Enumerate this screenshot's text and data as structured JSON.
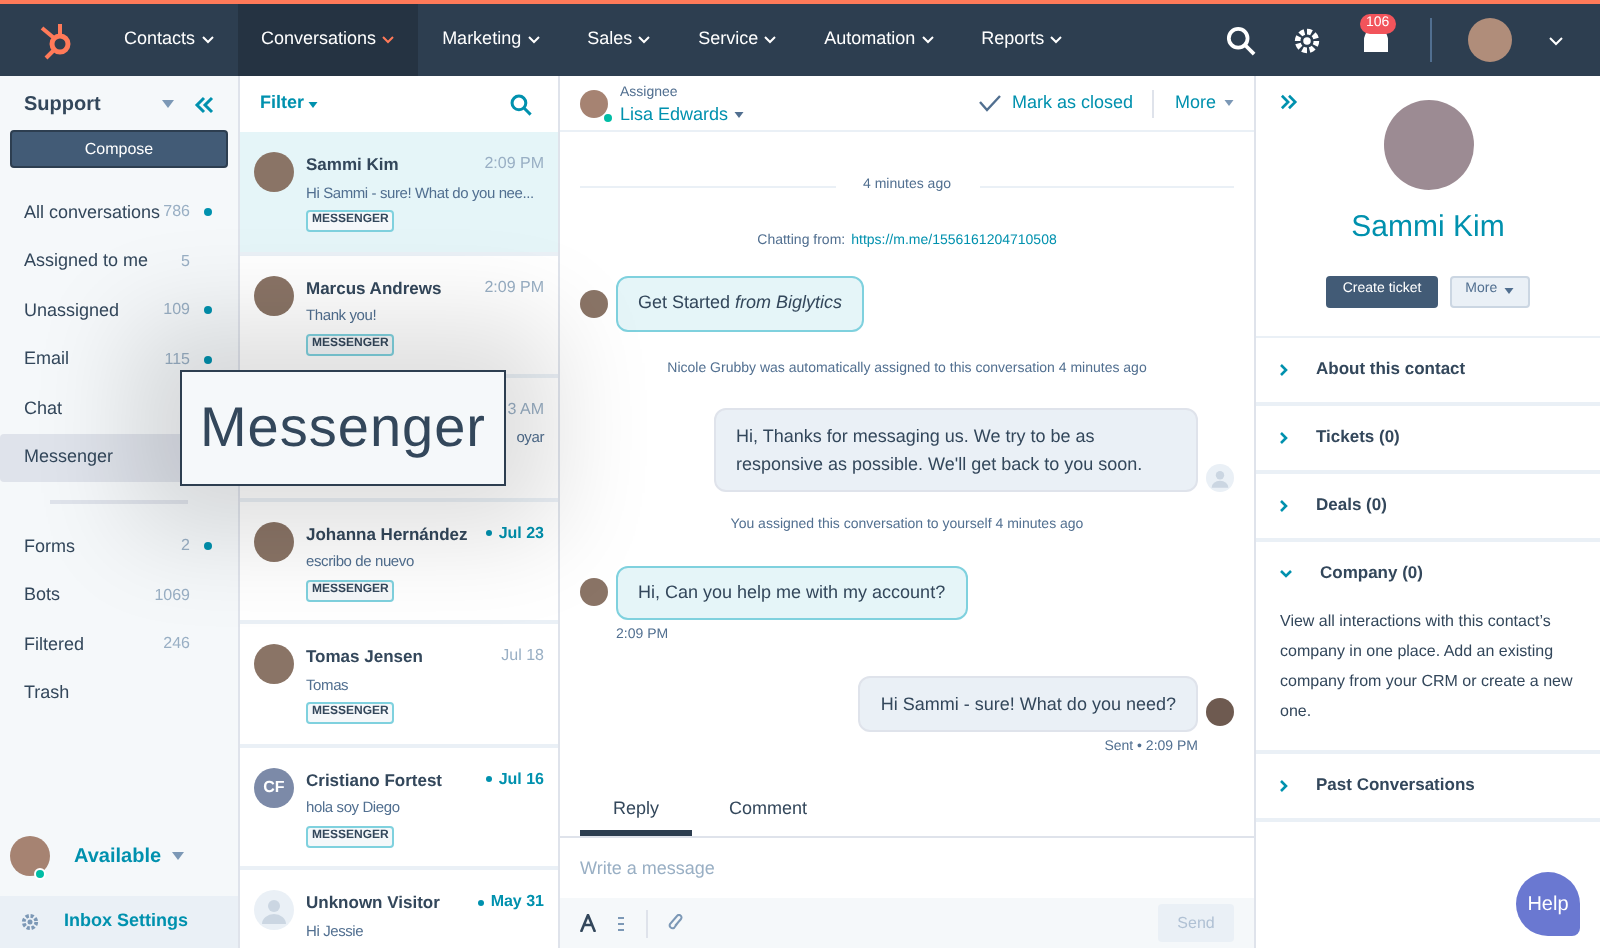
{
  "nav": {
    "items": [
      {
        "label": "Contacts",
        "selected": false
      },
      {
        "label": "Conversations",
        "selected": true
      },
      {
        "label": "Marketing",
        "selected": false
      },
      {
        "label": "Sales",
        "selected": false
      },
      {
        "label": "Service",
        "selected": false
      },
      {
        "label": "Automation",
        "selected": false
      },
      {
        "label": "Reports",
        "selected": false
      }
    ],
    "notifications": "106"
  },
  "sidebar": {
    "inbox": "Support",
    "compose": "Compose",
    "items": [
      {
        "label": "All conversations",
        "count": "786",
        "unread": true,
        "selected": false
      },
      {
        "label": "Assigned to me",
        "count": "5",
        "unread": false,
        "selected": false
      },
      {
        "label": "Unassigned",
        "count": "109",
        "unread": true,
        "selected": false
      },
      {
        "label": "Email",
        "count": "115",
        "unread": true,
        "selected": false
      },
      {
        "label": "Chat",
        "unread": false,
        "selected": false
      },
      {
        "label": "Messenger",
        "unread": false,
        "selected": true
      }
    ],
    "other_items": [
      {
        "label": "Forms",
        "count": "2",
        "unread": true,
        "selected": false
      },
      {
        "label": "Bots",
        "count": "1069",
        "unread": false,
        "selected": false
      },
      {
        "label": "Filtered",
        "count": "246",
        "unread": false,
        "selected": false
      },
      {
        "label": "Trash",
        "unread": false,
        "selected": false
      }
    ],
    "status": "Available",
    "settings": "Inbox Settings"
  },
  "conversations": {
    "filter": "Filter",
    "items": [
      {
        "photo": true,
        "name": "Sammi Kim",
        "time": "2:09 PM",
        "preview": "Hi Sammi - sure! What do you nee...",
        "tag": "MESSENGER",
        "unread": false,
        "selected": true
      },
      {
        "photo": true,
        "name": "Marcus Andrews",
        "time": "2:09 PM",
        "preview": "Thank you!",
        "tag": "MESSENGER",
        "unread": false,
        "selected": false
      },
      {
        "time": "3 AM",
        "preview": "oyar",
        "unread": false,
        "selected": false
      },
      {
        "photo": true,
        "name": "Johanna Hernández",
        "time": "Jul 23",
        "preview": "escribo de nuevo",
        "tag": "MESSENGER",
        "unread": true,
        "selected": false
      },
      {
        "photo": true,
        "name": "Tomas Jensen",
        "time": "Jul 18",
        "preview": "Tomas",
        "tag": "MESSENGER",
        "unread": false,
        "selected": false
      },
      {
        "photo": false,
        "initials": "CF",
        "name": "Cristiano Fortest",
        "time": "Jul 16",
        "preview": "hola soy Diego",
        "tag": "MESSENGER",
        "unread": true,
        "selected": false
      },
      {
        "photo": false,
        "name": "Unknown Visitor",
        "time": "May 31",
        "preview": "Hi Jessie",
        "unread": true,
        "selected": false
      }
    ]
  },
  "callout": "Messenger",
  "chat": {
    "assignee_label": "Assignee",
    "assignee": "Lisa Edwards",
    "mark_closed": "Mark as closed",
    "more": "More",
    "timeline": [
      {
        "kind": "divider",
        "text": "4 minutes ago"
      },
      {
        "kind": "source",
        "text": "Chatting from:",
        "link": "https://m.me/1556161204710508"
      },
      {
        "kind": "incoming",
        "text": "Get Started *from Biglytics*"
      },
      {
        "kind": "system",
        "text": "Nicole Grubby was automatically assigned to this conversation 4 minutes ago"
      },
      {
        "kind": "outgoing",
        "agent_photo": false,
        "text": "Hi, Thanks for messaging us. We try to be as responsive as possible. We'll get back to you soon."
      },
      {
        "kind": "system",
        "text": "You assigned this conversation to yourself 4 minutes ago"
      },
      {
        "kind": "incoming",
        "text": "Hi, Can you help me with my account?",
        "meta": "2:09 PM"
      },
      {
        "kind": "outgoing",
        "agent_photo": true,
        "text": "Hi Sammi - sure! What do you need?",
        "meta": "Sent • 2:09 PM"
      }
    ],
    "tabs": [
      {
        "label": "Reply",
        "selected": true
      },
      {
        "label": "Comment",
        "selected": false
      }
    ],
    "placeholder": "Write a message",
    "send": "Send",
    "send_disabled": true
  },
  "contact": {
    "name": "Sammi Kim",
    "create_ticket": "Create ticket",
    "more": "More",
    "sections": [
      {
        "title": "About this contact",
        "expanded": false
      },
      {
        "title": "Tickets (0)",
        "expanded": false
      },
      {
        "title": "Deals (0)",
        "expanded": false
      },
      {
        "title": "Company (0)",
        "expanded": true,
        "body": "View all interactions with this contact’s company in one place. Add an existing company from your CRM or create a new one."
      },
      {
        "title": "Past Conversations",
        "expanded": false
      }
    ]
  },
  "help": "Help"
}
